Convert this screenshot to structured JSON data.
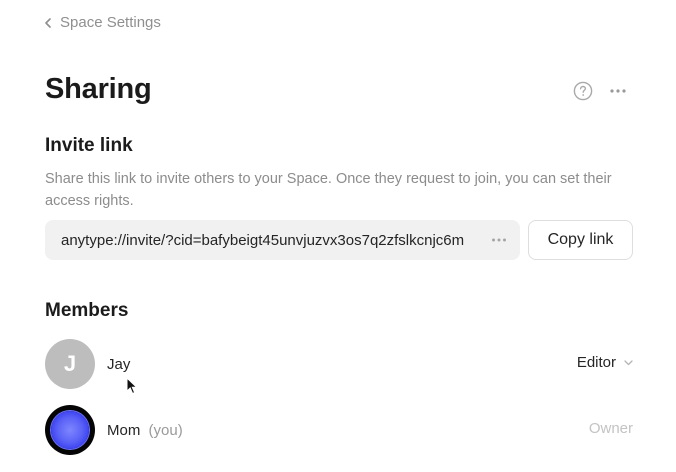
{
  "breadcrumb": {
    "back_label": "Space Settings"
  },
  "page": {
    "title": "Sharing"
  },
  "icons": {
    "help": "help-circle-icon",
    "more": "more-horizontal-icon",
    "back": "chevron-left-icon"
  },
  "invite": {
    "heading": "Invite link",
    "description": "Share this link to invite others to your Space. Once they request to join, you can set their access rights.",
    "link_value": "anytype://invite/?cid=bafybeigt45unvjuzvx3os7q2zfslkcnjc6m",
    "copy_label": "Copy link"
  },
  "members": {
    "heading": "Members",
    "list": [
      {
        "initial": "J",
        "name": "Jay",
        "suffix": "",
        "role": "Editor",
        "role_editable": true
      },
      {
        "initial": "",
        "name": "Mom",
        "suffix": "(you)",
        "role": "Owner",
        "role_editable": false
      }
    ]
  },
  "colors": {
    "accent_avatar": "#5b63f7",
    "muted_text": "#8c8c8c",
    "field_bg": "#f1f1f1"
  }
}
